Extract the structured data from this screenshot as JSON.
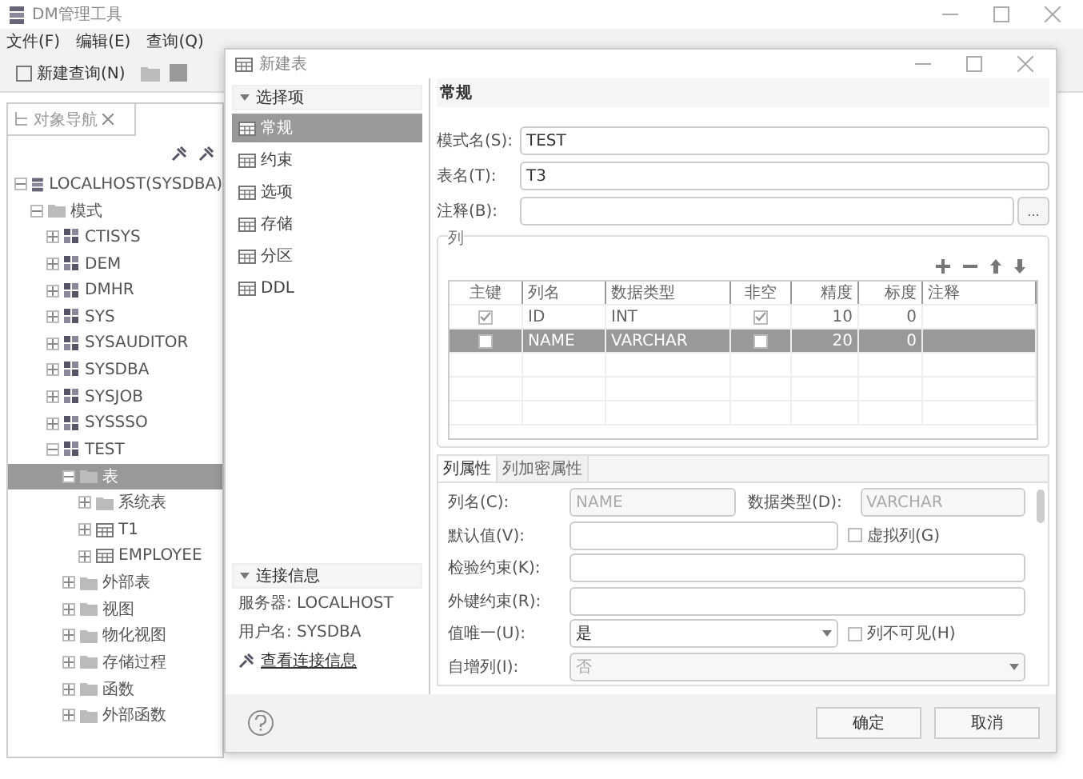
{
  "app_window": {
    "title": "DM管理工具",
    "menu": [
      "文件(F)",
      "编辑(E)",
      "查询(Q)"
    ],
    "toolbar_button": "新建查询(N)"
  },
  "navigator": {
    "tab": "对象导航",
    "tree": [
      {
        "label": "LOCALHOST(SYSDBA)",
        "kind": "server",
        "expanded": true,
        "selected": false,
        "children": [
          {
            "label": "模式",
            "kind": "folder",
            "expanded": true,
            "selected": false,
            "children": [
              {
                "label": "CTISYS",
                "kind": "schema",
                "expanded": false,
                "selected": false
              },
              {
                "label": "DEM",
                "kind": "schema",
                "expanded": false,
                "selected": false
              },
              {
                "label": "DMHR",
                "kind": "schema",
                "expanded": false,
                "selected": false
              },
              {
                "label": "SYS",
                "kind": "schema",
                "expanded": false,
                "selected": false
              },
              {
                "label": "SYSAUDITOR",
                "kind": "schema",
                "expanded": false,
                "selected": false
              },
              {
                "label": "SYSDBA",
                "kind": "schema",
                "expanded": false,
                "selected": false
              },
              {
                "label": "SYSJOB",
                "kind": "schema",
                "expanded": false,
                "selected": false
              },
              {
                "label": "SYSSSO",
                "kind": "schema",
                "expanded": false,
                "selected": false
              },
              {
                "label": "TEST",
                "kind": "schema",
                "expanded": true,
                "selected": false,
                "children": [
                  {
                    "label": "表",
                    "kind": "folder",
                    "expanded": true,
                    "selected": true,
                    "children": [
                      {
                        "label": "系统表",
                        "kind": "folder",
                        "expanded": false,
                        "selected": false
                      },
                      {
                        "label": "T1",
                        "kind": "table",
                        "expanded": false,
                        "selected": false
                      },
                      {
                        "label": "EMPLOYEE",
                        "kind": "table",
                        "expanded": false,
                        "selected": false
                      }
                    ]
                  },
                  {
                    "label": "外部表",
                    "kind": "folder",
                    "expanded": false,
                    "selected": false
                  },
                  {
                    "label": "视图",
                    "kind": "folder",
                    "expanded": false,
                    "selected": false
                  },
                  {
                    "label": "物化视图",
                    "kind": "folder",
                    "expanded": false,
                    "selected": false
                  },
                  {
                    "label": "存储过程",
                    "kind": "folder",
                    "expanded": false,
                    "selected": false
                  },
                  {
                    "label": "函数",
                    "kind": "folder",
                    "expanded": false,
                    "selected": false
                  },
                  {
                    "label": "外部函数",
                    "kind": "folder",
                    "expanded": false,
                    "selected": false
                  }
                ]
              }
            ]
          }
        ]
      }
    ]
  },
  "dialog": {
    "title": "新建表",
    "options_header": "选择项",
    "options": [
      {
        "label": "常规",
        "selected": true
      },
      {
        "label": "约束",
        "selected": false
      },
      {
        "label": "选项",
        "selected": false
      },
      {
        "label": "存储",
        "selected": false
      },
      {
        "label": "分区",
        "selected": false
      },
      {
        "label": "DDL",
        "selected": false
      }
    ],
    "connection": {
      "header": "连接信息",
      "server": "服务器: LOCALHOST",
      "user": "用户名: SYSDBA",
      "link": "查看连接信息"
    },
    "heading": "常规",
    "fields": [
      {
        "label": "模式名(S):",
        "value": "TEST"
      },
      {
        "label": "表名(T):",
        "value": "T3"
      },
      {
        "label": "注释(B):",
        "button": "..."
      }
    ],
    "columns": {
      "legend": "列",
      "headers": [
        "主键",
        "列名",
        "数据类型",
        "非空",
        "精度",
        "标度",
        "注释"
      ],
      "rows": [
        {
          "primary_key": true,
          "name": "ID",
          "type": "INT",
          "not_null": true,
          "precision": "10",
          "scale": "0",
          "selected": false
        },
        {
          "primary_key": false,
          "name": "NAME",
          "type": "VARCHAR",
          "not_null": false,
          "precision": "20",
          "scale": "0",
          "selected": true
        }
      ]
    },
    "property_tabs": [
      {
        "label": "列属性",
        "selected": true
      },
      {
        "label": "列加密属性",
        "selected": false
      }
    ],
    "properties": {
      "name_label": "列名(C):",
      "name_value": "NAME",
      "type_label": "数据类型(D):",
      "type_value": "VARCHAR",
      "default_label": "默认值(V):",
      "virtual": {
        "label": "虚拟列(G)",
        "checked": false
      },
      "check_label": "检验约束(K):",
      "fk_label": "外键约束(R):",
      "unique_label": "值唯一(U):",
      "unique_value": "是",
      "invisible": {
        "label": "列不可见(H)",
        "checked": false
      },
      "auto_label": "自增列(I):",
      "auto_value": "否"
    },
    "buttons": [
      "确定",
      "取消"
    ]
  }
}
